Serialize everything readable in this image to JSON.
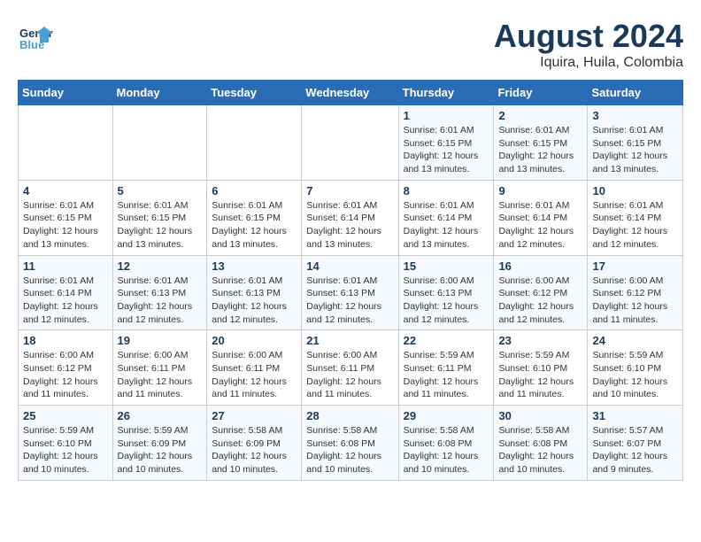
{
  "header": {
    "logo_line1": "General",
    "logo_line2": "Blue",
    "month_year": "August 2024",
    "location": "Iquira, Huila, Colombia"
  },
  "weekdays": [
    "Sunday",
    "Monday",
    "Tuesday",
    "Wednesday",
    "Thursday",
    "Friday",
    "Saturday"
  ],
  "weeks": [
    [
      {
        "day": "",
        "info": ""
      },
      {
        "day": "",
        "info": ""
      },
      {
        "day": "",
        "info": ""
      },
      {
        "day": "",
        "info": ""
      },
      {
        "day": "1",
        "info": "Sunrise: 6:01 AM\nSunset: 6:15 PM\nDaylight: 12 hours\nand 13 minutes."
      },
      {
        "day": "2",
        "info": "Sunrise: 6:01 AM\nSunset: 6:15 PM\nDaylight: 12 hours\nand 13 minutes."
      },
      {
        "day": "3",
        "info": "Sunrise: 6:01 AM\nSunset: 6:15 PM\nDaylight: 12 hours\nand 13 minutes."
      }
    ],
    [
      {
        "day": "4",
        "info": "Sunrise: 6:01 AM\nSunset: 6:15 PM\nDaylight: 12 hours\nand 13 minutes."
      },
      {
        "day": "5",
        "info": "Sunrise: 6:01 AM\nSunset: 6:15 PM\nDaylight: 12 hours\nand 13 minutes."
      },
      {
        "day": "6",
        "info": "Sunrise: 6:01 AM\nSunset: 6:15 PM\nDaylight: 12 hours\nand 13 minutes."
      },
      {
        "day": "7",
        "info": "Sunrise: 6:01 AM\nSunset: 6:14 PM\nDaylight: 12 hours\nand 13 minutes."
      },
      {
        "day": "8",
        "info": "Sunrise: 6:01 AM\nSunset: 6:14 PM\nDaylight: 12 hours\nand 13 minutes."
      },
      {
        "day": "9",
        "info": "Sunrise: 6:01 AM\nSunset: 6:14 PM\nDaylight: 12 hours\nand 12 minutes."
      },
      {
        "day": "10",
        "info": "Sunrise: 6:01 AM\nSunset: 6:14 PM\nDaylight: 12 hours\nand 12 minutes."
      }
    ],
    [
      {
        "day": "11",
        "info": "Sunrise: 6:01 AM\nSunset: 6:14 PM\nDaylight: 12 hours\nand 12 minutes."
      },
      {
        "day": "12",
        "info": "Sunrise: 6:01 AM\nSunset: 6:13 PM\nDaylight: 12 hours\nand 12 minutes."
      },
      {
        "day": "13",
        "info": "Sunrise: 6:01 AM\nSunset: 6:13 PM\nDaylight: 12 hours\nand 12 minutes."
      },
      {
        "day": "14",
        "info": "Sunrise: 6:01 AM\nSunset: 6:13 PM\nDaylight: 12 hours\nand 12 minutes."
      },
      {
        "day": "15",
        "info": "Sunrise: 6:00 AM\nSunset: 6:13 PM\nDaylight: 12 hours\nand 12 minutes."
      },
      {
        "day": "16",
        "info": "Sunrise: 6:00 AM\nSunset: 6:12 PM\nDaylight: 12 hours\nand 12 minutes."
      },
      {
        "day": "17",
        "info": "Sunrise: 6:00 AM\nSunset: 6:12 PM\nDaylight: 12 hours\nand 11 minutes."
      }
    ],
    [
      {
        "day": "18",
        "info": "Sunrise: 6:00 AM\nSunset: 6:12 PM\nDaylight: 12 hours\nand 11 minutes."
      },
      {
        "day": "19",
        "info": "Sunrise: 6:00 AM\nSunset: 6:11 PM\nDaylight: 12 hours\nand 11 minutes."
      },
      {
        "day": "20",
        "info": "Sunrise: 6:00 AM\nSunset: 6:11 PM\nDaylight: 12 hours\nand 11 minutes."
      },
      {
        "day": "21",
        "info": "Sunrise: 6:00 AM\nSunset: 6:11 PM\nDaylight: 12 hours\nand 11 minutes."
      },
      {
        "day": "22",
        "info": "Sunrise: 5:59 AM\nSunset: 6:11 PM\nDaylight: 12 hours\nand 11 minutes."
      },
      {
        "day": "23",
        "info": "Sunrise: 5:59 AM\nSunset: 6:10 PM\nDaylight: 12 hours\nand 11 minutes."
      },
      {
        "day": "24",
        "info": "Sunrise: 5:59 AM\nSunset: 6:10 PM\nDaylight: 12 hours\nand 10 minutes."
      }
    ],
    [
      {
        "day": "25",
        "info": "Sunrise: 5:59 AM\nSunset: 6:10 PM\nDaylight: 12 hours\nand 10 minutes."
      },
      {
        "day": "26",
        "info": "Sunrise: 5:59 AM\nSunset: 6:09 PM\nDaylight: 12 hours\nand 10 minutes."
      },
      {
        "day": "27",
        "info": "Sunrise: 5:58 AM\nSunset: 6:09 PM\nDaylight: 12 hours\nand 10 minutes."
      },
      {
        "day": "28",
        "info": "Sunrise: 5:58 AM\nSunset: 6:08 PM\nDaylight: 12 hours\nand 10 minutes."
      },
      {
        "day": "29",
        "info": "Sunrise: 5:58 AM\nSunset: 6:08 PM\nDaylight: 12 hours\nand 10 minutes."
      },
      {
        "day": "30",
        "info": "Sunrise: 5:58 AM\nSunset: 6:08 PM\nDaylight: 12 hours\nand 10 minutes."
      },
      {
        "day": "31",
        "info": "Sunrise: 5:57 AM\nSunset: 6:07 PM\nDaylight: 12 hours\nand 9 minutes."
      }
    ]
  ]
}
